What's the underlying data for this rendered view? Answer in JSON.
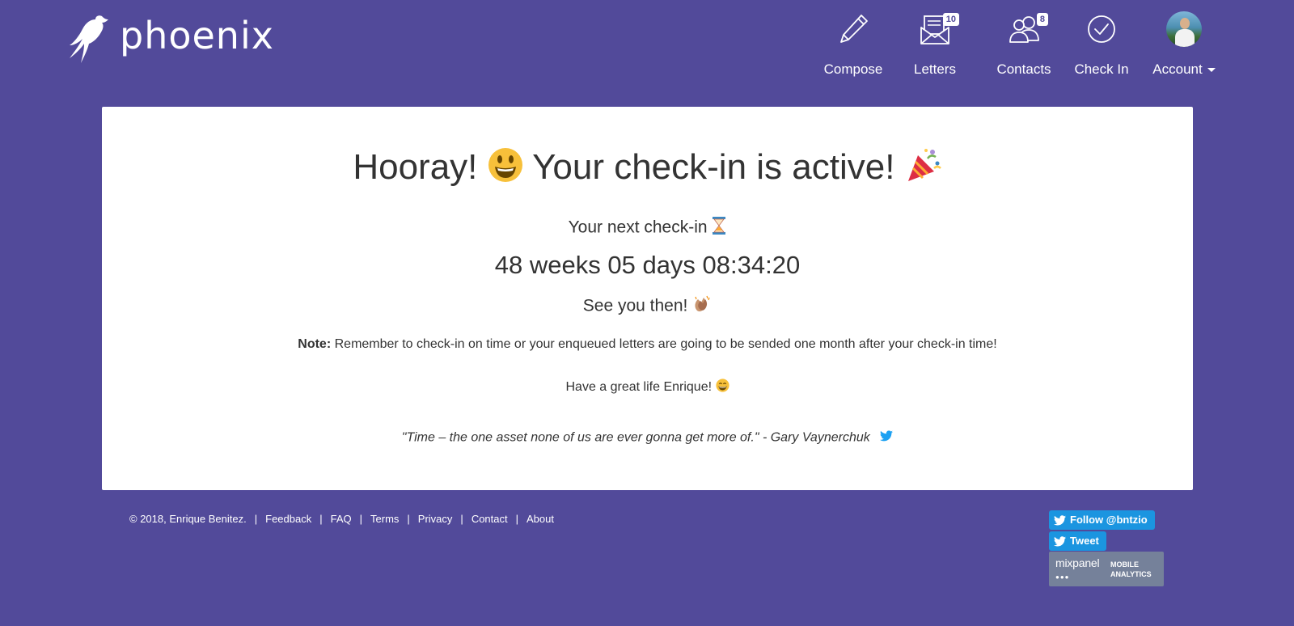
{
  "brand": {
    "name": "phoenix"
  },
  "nav": {
    "items": [
      {
        "label": "Compose",
        "icon": "pencil-icon"
      },
      {
        "label": "Letters",
        "icon": "letters-icon",
        "badge": "10"
      },
      {
        "label": "Contacts",
        "icon": "contacts-icon",
        "badge": "8"
      },
      {
        "label": "Check In",
        "icon": "check-circle-icon"
      },
      {
        "label": "Account",
        "icon": "avatar"
      }
    ]
  },
  "main": {
    "title_pre": "Hooray!",
    "title_post": "Your check-in is active!",
    "next_label": "Your next check-in",
    "countdown": "48 weeks 05 days 08:34:20",
    "see_you": "See you then!",
    "note_label": "Note:",
    "note_text": "Remember to check-in on time or your enqueued letters are going to be sended one month after your check-in time!",
    "greeting": "Have a great life Enrique!",
    "quote": "\"Time – the one asset none of us are ever gonna get more of.\" - Gary Vaynerchuk"
  },
  "footer": {
    "copyright": "© 2018, Enrique Benitez.",
    "links": [
      "Feedback",
      "FAQ",
      "Terms",
      "Privacy",
      "Contact",
      "About"
    ],
    "follow_label": "Follow @bntzio",
    "tweet_label": "Tweet",
    "mixpanel": {
      "logo": "mixpanel",
      "line1": "MOBILE",
      "line2": "ANALYTICS"
    }
  },
  "colors": {
    "background": "#524a9a",
    "twitter": "#1b95e0"
  }
}
